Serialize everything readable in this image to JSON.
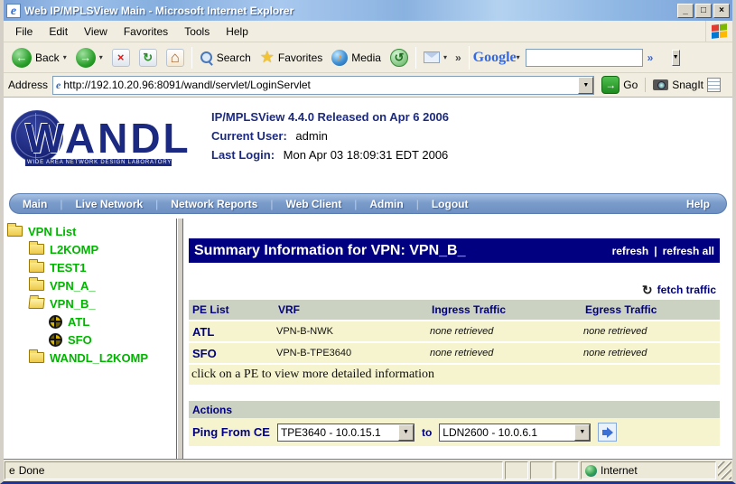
{
  "window": {
    "title": "Web IP/MPLSView Main - Microsoft Internet Explorer",
    "buttons": {
      "minimize": "_",
      "maximize": "□",
      "close": "×"
    }
  },
  "menubar": {
    "items": [
      "File",
      "Edit",
      "View",
      "Favorites",
      "Tools",
      "Help"
    ]
  },
  "toolbar": {
    "back_label": "Back",
    "search_label": "Search",
    "favorites_label": "Favorites",
    "media_label": "Media",
    "overflow_chevron": "»",
    "google": {
      "label": "Google",
      "chevron": "»",
      "search_value": ""
    }
  },
  "addressbar": {
    "label": "Address",
    "url": "http://192.10.20.96:8091/wandl/servlet/LoginServlet",
    "go_label": "Go",
    "snagit_label": "SnagIt"
  },
  "header": {
    "logo": {
      "text": "WANDL",
      "tagline": "WIDE AREA NETWORK DESIGN LABORATORY"
    },
    "product_line": "IP/MPLSView 4.4.0 Released on Apr 6 2006",
    "current_user_label": "Current User:",
    "current_user_value": "admin",
    "last_login_label": "Last Login:",
    "last_login_value": "Mon Apr 03 18:09:31 EDT 2006"
  },
  "navbar": {
    "items": [
      "Main",
      "Live Network",
      "Network Reports",
      "Web Client",
      "Admin",
      "Logout"
    ],
    "divider": "|",
    "help": "Help"
  },
  "sidebar": {
    "root": "VPN List",
    "items": [
      {
        "label": "L2KOMP"
      },
      {
        "label": "TEST1"
      },
      {
        "label": "VPN_A_"
      },
      {
        "label": "VPN_B_"
      },
      {
        "label": "ATL"
      },
      {
        "label": "SFO"
      },
      {
        "label": "WANDL_L2KOMP"
      }
    ]
  },
  "main": {
    "title": "Summary Information for VPN: VPN_B_",
    "refresh": "refresh",
    "links_divider": "|",
    "refresh_all": "refresh all",
    "fetch_traffic": "fetch traffic",
    "fetch_icon": "↻",
    "table": {
      "headers": [
        "PE List",
        "VRF",
        "Ingress Traffic",
        "Egress Traffic"
      ],
      "rows": [
        {
          "pe": "ATL",
          "vrf": "VPN-B-NWK",
          "ingress": "none retrieved",
          "egress": "none retrieved"
        },
        {
          "pe": "SFO",
          "vrf": "VPN-B-TPE3640",
          "ingress": "none retrieved",
          "egress": "none retrieved"
        }
      ],
      "note": "click on a PE to view more detailed information"
    },
    "actions": {
      "title": "Actions",
      "ping_label": "Ping From CE",
      "from_value": "TPE3640 - 10.0.15.1",
      "to_label": "to",
      "to_value": "LDN2600 - 10.0.6.1"
    }
  },
  "statusbar": {
    "status": "Done",
    "zone": "Internet"
  },
  "colors": {
    "accent_navy": "#000080",
    "tree_green": "#00b400",
    "row_yellow": "#f6f4cf",
    "header_sage": "#ccd2c2",
    "nav_blue": "#7b9ccb"
  }
}
